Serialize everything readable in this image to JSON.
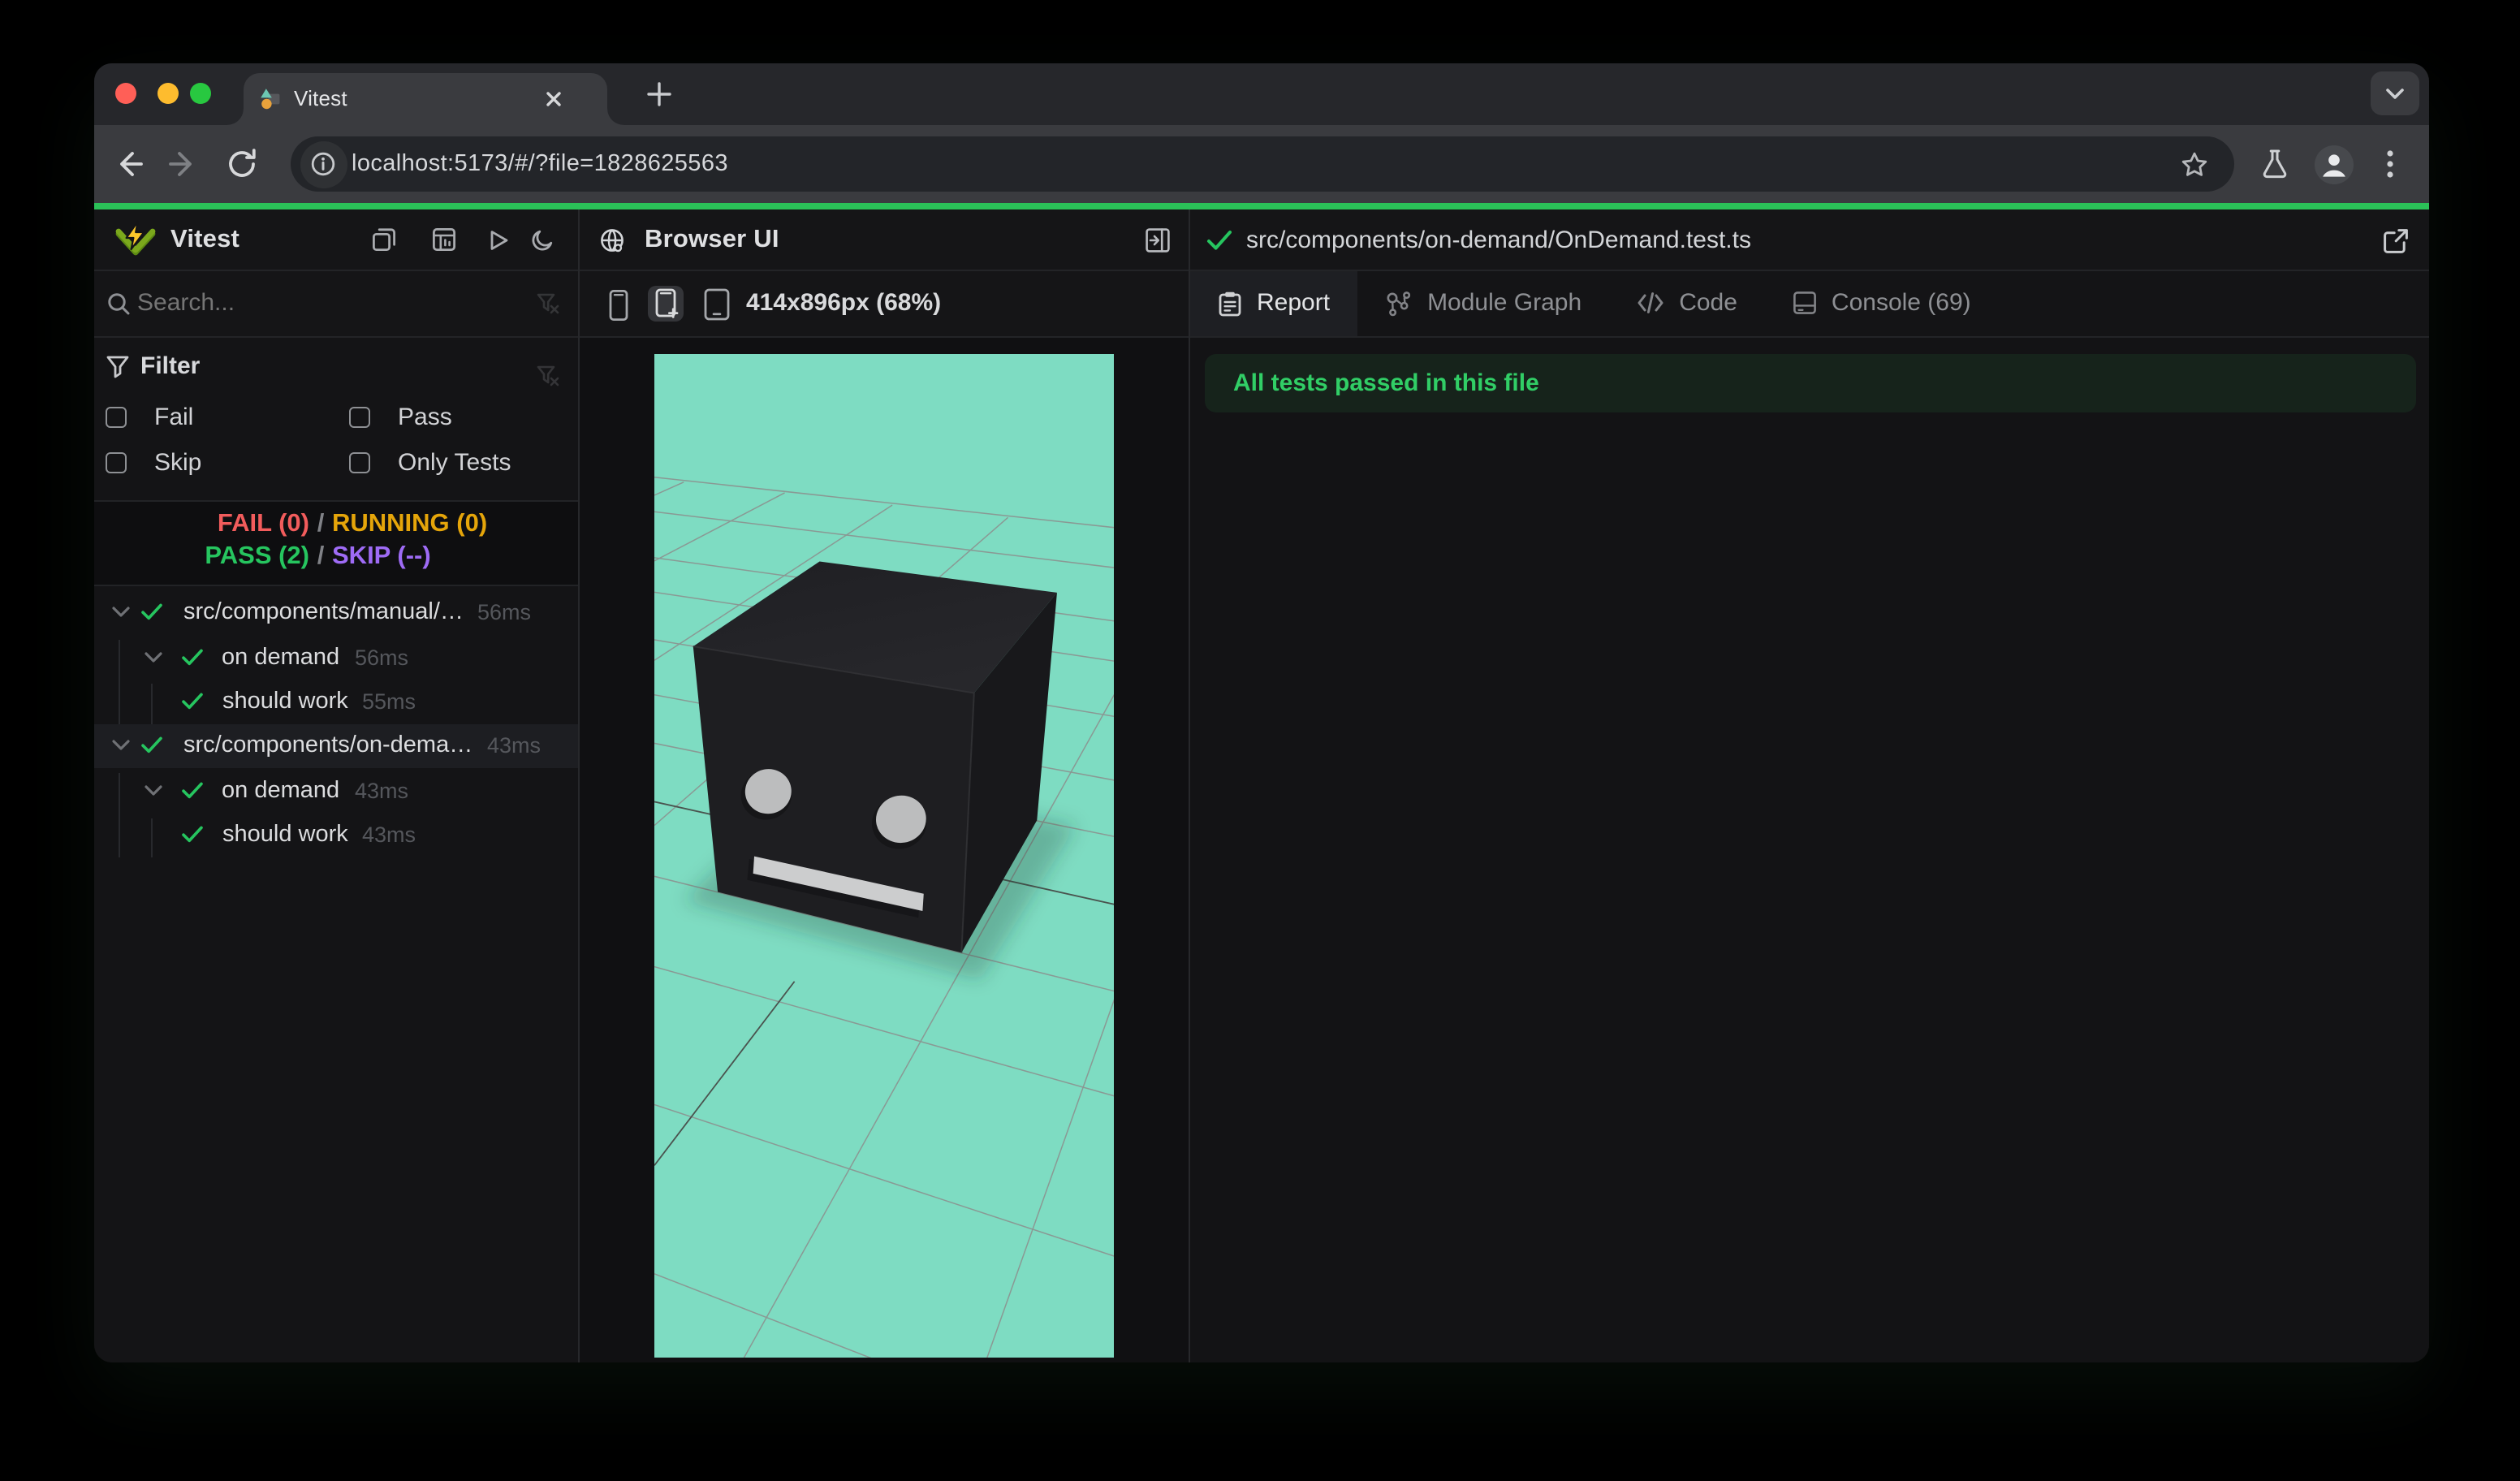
{
  "browser": {
    "tab_title": "Vitest",
    "url": "localhost:5173/#/?file=1828625563",
    "traffic_lights": {
      "close": "#FF5F57",
      "minimize": "#FEBC2E",
      "zoom": "#28C840"
    },
    "accent_line_color": "#2BC158",
    "icons": [
      "back-icon",
      "forward-icon",
      "reload-icon",
      "site-info-icon",
      "bookmark-star-icon",
      "experiments-flask-icon",
      "profile-avatar-icon",
      "menu-kebab-icon",
      "new-tab-icon",
      "tab-close-icon",
      "tab-search-chevron-icon"
    ]
  },
  "sidebar": {
    "app_title": "Vitest",
    "header_icons": [
      "dock-panel-icon",
      "dashboard-icon",
      "run-all-icon",
      "dark-mode-moon-icon"
    ],
    "search": {
      "placeholder": "Search...",
      "value": ""
    },
    "filter": {
      "title": "Filter",
      "checkboxes": [
        {
          "label": "Fail",
          "checked": false
        },
        {
          "label": "Pass",
          "checked": false
        },
        {
          "label": "Skip",
          "checked": false
        },
        {
          "label": "Only Tests",
          "checked": false
        }
      ]
    },
    "summary": {
      "fail_label": "FAIL (0)",
      "running_label": "RUNNING (0)",
      "pass_label": "PASS (2)",
      "skip_label": "SKIP (--)",
      "separator": "/"
    },
    "tree": [
      {
        "label": "src/components/manual/…",
        "duration": "56ms",
        "level": 0,
        "expandable": true,
        "status": "pass",
        "selected": false
      },
      {
        "label": "on demand",
        "duration": "56ms",
        "level": 1,
        "expandable": true,
        "status": "pass",
        "selected": false
      },
      {
        "label": "should work",
        "duration": "55ms",
        "level": 2,
        "expandable": false,
        "status": "pass",
        "selected": false
      },
      {
        "label": "src/components/on-dema…",
        "duration": "43ms",
        "level": 0,
        "expandable": true,
        "status": "pass",
        "selected": true
      },
      {
        "label": "on demand",
        "duration": "43ms",
        "level": 1,
        "expandable": true,
        "status": "pass",
        "selected": false
      },
      {
        "label": "should work",
        "duration": "43ms",
        "level": 2,
        "expandable": false,
        "status": "pass",
        "selected": false
      }
    ],
    "status_colors": {
      "fail": "#F25C5C",
      "running": "#E5A50A",
      "pass": "#26C55F",
      "skip": "#9E6BF5"
    }
  },
  "preview": {
    "title": "Browser UI",
    "header_icons": [
      "globe-icon",
      "panel-right-open-icon"
    ],
    "device_icons": [
      "smartphone-icon",
      "smartphone-active-icon",
      "tablet-icon"
    ],
    "viewport_label": "414x896px (68%)",
    "scene": {
      "background": "#7EDCC2",
      "description": "3D robot-head cube on grid floor",
      "grid_line_color": "#8A9994",
      "grid_center_line_color": "#4A534E",
      "cube_colors": {
        "top": "#26262A",
        "front": "#1E1E21",
        "right": "#18181B"
      },
      "eye_color": "#BCBDBE",
      "mouth_color": "#CCCDCE"
    }
  },
  "inspector": {
    "file_path": "src/components/on-demand/OnDemand.test.ts",
    "file_status": "pass",
    "header_icons": [
      "check-icon",
      "external-link-icon"
    ],
    "tabs": [
      {
        "label": "Report",
        "icon": "report-clipboard-icon",
        "active": true
      },
      {
        "label": "Module Graph",
        "icon": "module-graph-icon",
        "active": false
      },
      {
        "label": "Code",
        "icon": "code-icon",
        "active": false
      },
      {
        "label": "Console (69)",
        "icon": "console-panel-icon",
        "active": false
      }
    ],
    "banner": {
      "text": "All tests passed in this file",
      "color": "#31CE66"
    }
  }
}
